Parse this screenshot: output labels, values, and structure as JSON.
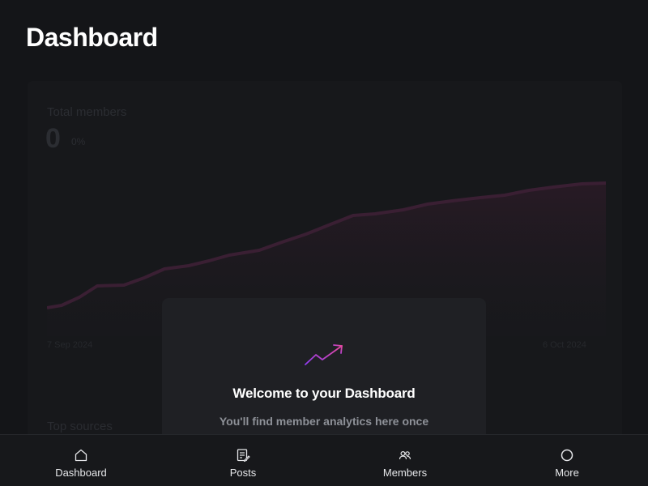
{
  "page": {
    "title": "Dashboard"
  },
  "background_card": {
    "metric_label": "Total members",
    "metric_value": "0",
    "metric_change": "0%",
    "date_start": "7 Sep 2024",
    "date_end": "6 Oct 2024",
    "sources_label": "Top sources"
  },
  "welcome": {
    "icon": "trending-up-icon",
    "title": "Welcome to your Dashboard",
    "text": "You'll find member analytics here once",
    "accent_colors": [
      "#8e3cf0",
      "#e84a9c"
    ]
  },
  "bottom_nav": {
    "items": [
      {
        "label": "Dashboard",
        "icon": "home-icon"
      },
      {
        "label": "Posts",
        "icon": "posts-icon"
      },
      {
        "label": "Members",
        "icon": "members-icon"
      },
      {
        "label": "More",
        "icon": "more-icon"
      }
    ]
  },
  "colors": {
    "background": "#141518",
    "card": "#1f2024",
    "text_primary": "#ffffff",
    "text_secondary": "#8e9198",
    "chart_line": "#3a1f33"
  }
}
